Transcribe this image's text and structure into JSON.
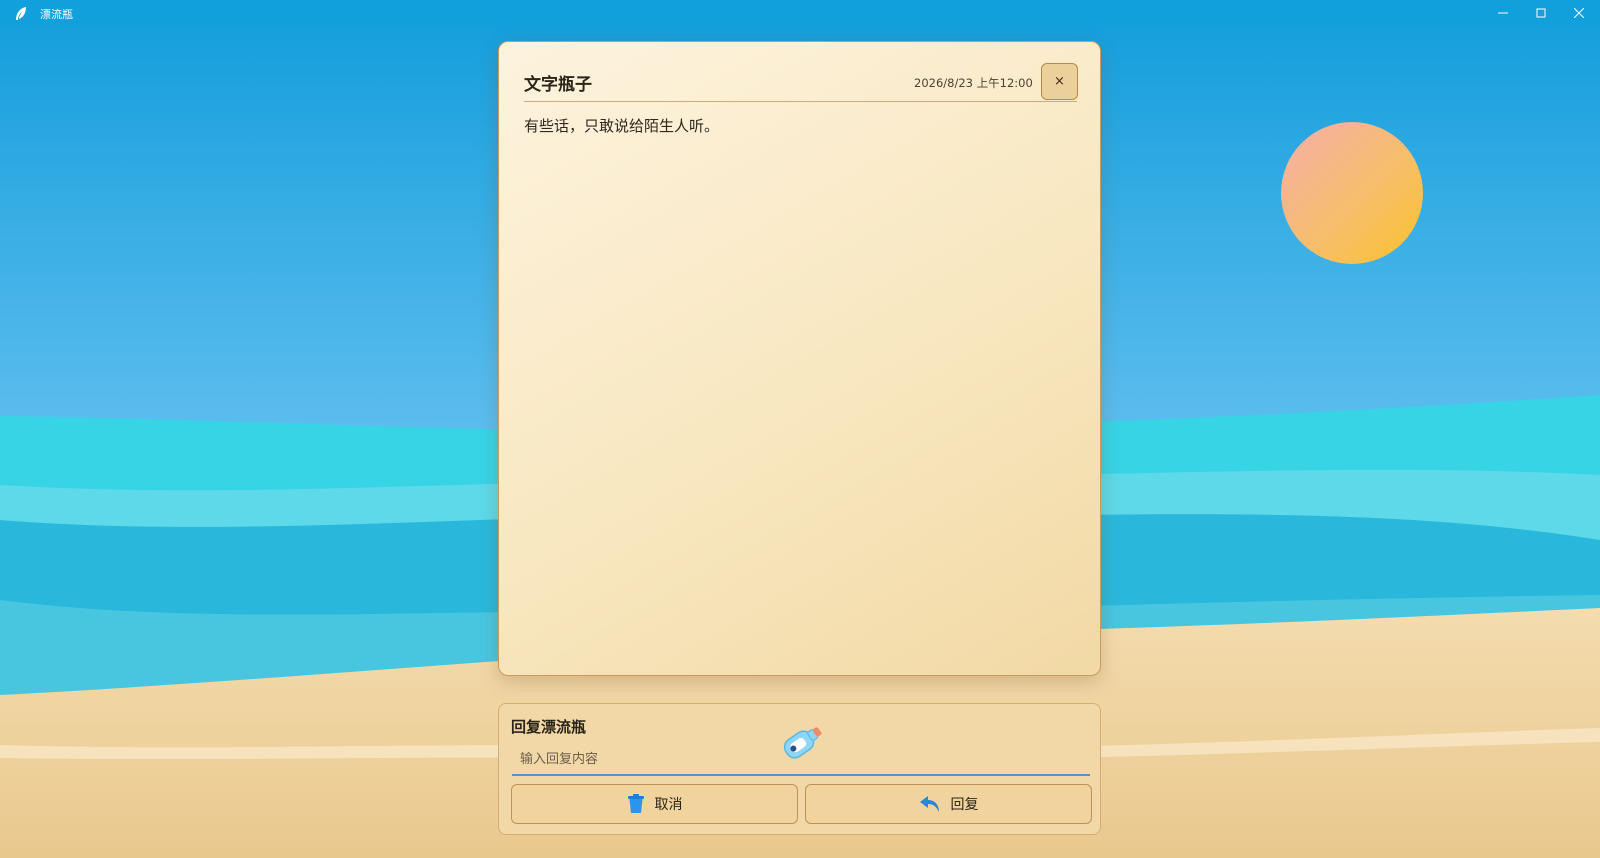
{
  "window": {
    "title": "漂流瓶",
    "controls": [
      "minimize",
      "maximize",
      "close"
    ]
  },
  "colors": {
    "titlebar": "#12a0dc",
    "sky_top": "#1a9fde",
    "sea": "#38d3e6",
    "sand": "#f0d6a4",
    "sun": "#f7c04a",
    "card_background": "#fbeccb",
    "input_underline": "#5a8ec8"
  },
  "card": {
    "title": "文字瓶子",
    "date": "2026/8/23 上午12:00",
    "close_glyph": "×",
    "message": "有些话，只敢说给陌生人听。"
  },
  "reply": {
    "title": "回复漂流瓶",
    "input_value": "",
    "input_placeholder": "输入回复内容",
    "cancel_label": "取消",
    "cancel_icon": "trash-bin-icon",
    "reply_label": "回复",
    "reply_icon": "reply-arrow-icon",
    "decoration_icon": "message-bottle-icon"
  }
}
